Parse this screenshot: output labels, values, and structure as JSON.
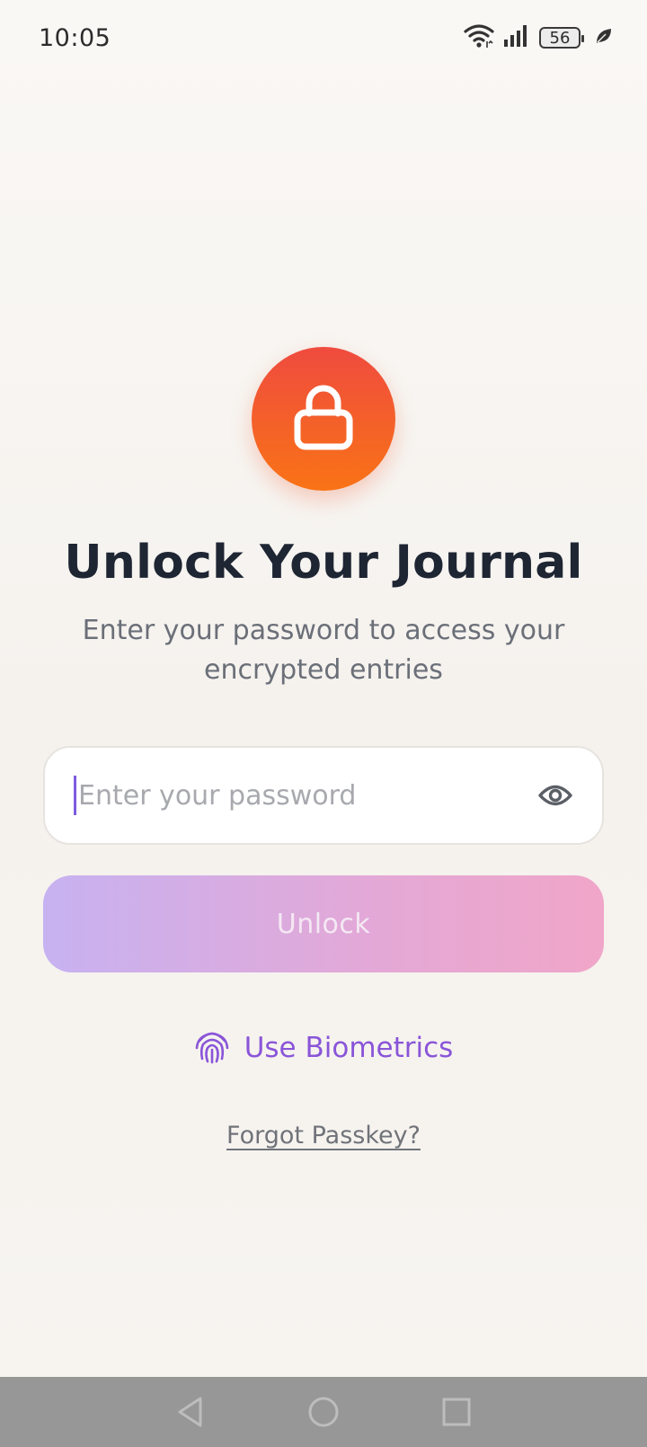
{
  "status_bar": {
    "time": "10:05",
    "battery_level": "56",
    "icons": [
      "wifi-icon",
      "signal-icon",
      "battery-icon",
      "leaf-icon"
    ]
  },
  "lock_icon": "lock-icon",
  "title": "Unlock Your Journal",
  "subtitle": "Enter your password to access your encrypted entries",
  "password_field": {
    "value": "",
    "placeholder": "Enter your password",
    "toggle_icon": "eye-icon"
  },
  "unlock_button": {
    "label": "Unlock"
  },
  "biometrics": {
    "label": "Use Biometrics",
    "icon": "fingerprint-icon"
  },
  "forgot_link": {
    "label": "Forgot Passkey?"
  },
  "nav_bar": {
    "icons": [
      "back-icon",
      "home-icon",
      "recents-icon"
    ]
  },
  "colors": {
    "accent_orange": "#f97316",
    "accent_red": "#ef4b3f",
    "accent_purple": "#8a55d8",
    "button_gradient_start": "#c7b2f1",
    "button_gradient_end": "#f0a6c8",
    "title": "#1e2533"
  }
}
